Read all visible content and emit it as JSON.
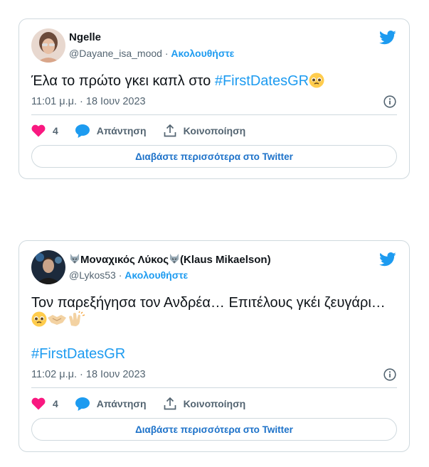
{
  "tweets": [
    {
      "display_name": "Ngelle",
      "handle": "@Dayane_isa_mood",
      "separator": " · ",
      "follow_label": "Ακολουθήστε",
      "text_before": "Έλα το πρώτο γκει καπλ στο ",
      "hashtag": "#FirstDatesGR",
      "timestamp": "11:01 μ.μ. · 18 Ιουν 2023",
      "like_count": "4",
      "reply_label": "Απάντηση",
      "share_label": "Κοινοποίηση",
      "read_more_label": "Διαβάστε περισσότερα στο Twitter"
    },
    {
      "display_name": "Μοναχικός Λύκος",
      "display_name_suffix": "(Klaus Mikaelson)",
      "handle": "@Lykos53",
      "separator": " · ",
      "follow_label": "Ακολουθήστε",
      "text": "Τον παρεξήγησα τον Ανδρέα… Επιτέλους γκέι ζευγάρι…",
      "hashtag": "#FirstDatesGR",
      "timestamp": "11:02 μ.μ. · 18 Ιουν 2023",
      "like_count": "4",
      "reply_label": "Απάντηση",
      "share_label": "Κοινοποίηση",
      "read_more_label": "Διαβάστε περισσότερα στο Twitter"
    }
  ],
  "colors": {
    "accent": "#1d9bf0",
    "like": "#f91880",
    "muted": "#536471",
    "border": "#cfd9de"
  },
  "icons": [
    "twitter-bird-icon",
    "info-icon",
    "heart-icon",
    "reply-bubble-icon",
    "share-icon",
    "wolf-emoji-icon",
    "pleading-face-emoji-icon",
    "handshake-emoji-icon",
    "clapping-hands-emoji-icon"
  ]
}
